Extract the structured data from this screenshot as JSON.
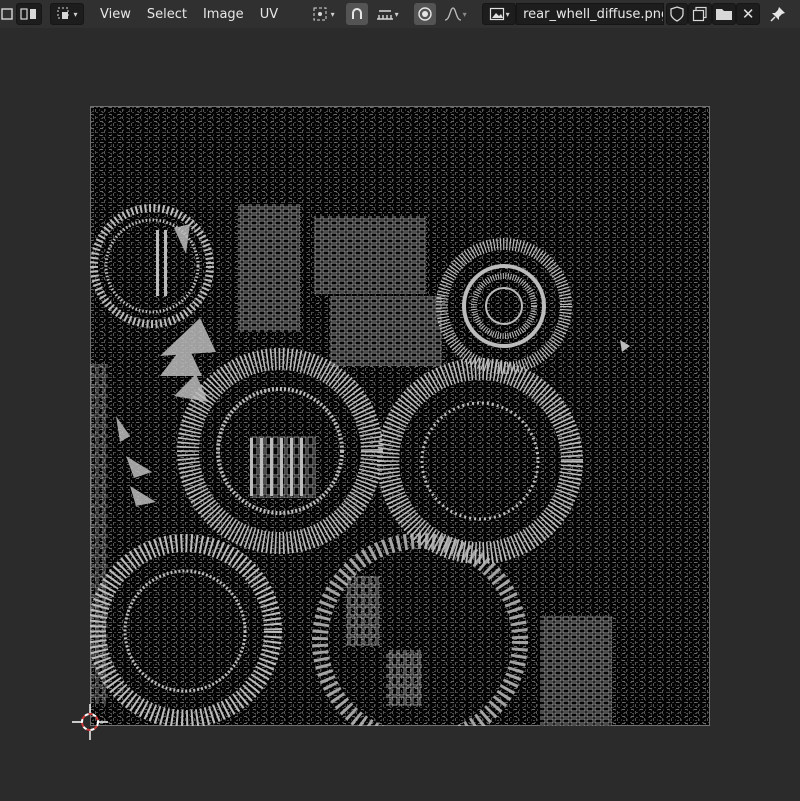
{
  "header": {
    "menus": [
      "View",
      "Select",
      "Image",
      "UV"
    ],
    "image_name": "rear_whell_diffuse.png"
  },
  "icons": {
    "editor_type": "uv-editor-icon",
    "sync": "uv-sync-icon",
    "select_mode": "select-mode-icon",
    "pivot": "pivot-icon",
    "snap": "snap-icon",
    "snap_target": "snap-increment-icon",
    "proportional": "proportional-edit-icon",
    "falloff": "falloff-curve-icon",
    "image_browse": "image-browse-icon",
    "fake_user": "fake-user-shield-icon",
    "new_image": "new-image-icon",
    "open_image": "open-folder-icon",
    "unlink": "close-icon",
    "pin": "pin-icon"
  },
  "colors": {
    "header_bg": "#303030",
    "viewport_bg": "#2b2b2b",
    "texture_bg": "#040404",
    "wireframe": "#bcbcbc",
    "cursor_red": "#d23a3a"
  }
}
